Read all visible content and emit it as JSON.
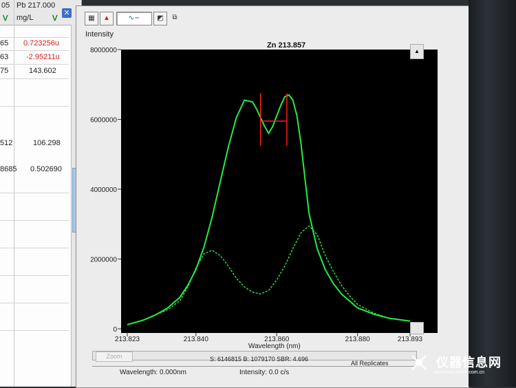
{
  "left_table": {
    "col1_header": "05",
    "col2_header": "Pb 217.000",
    "col1_unit_icon": "tuning-fork-icon",
    "col2_unit": "mg/L",
    "rows": [
      {
        "a": "65",
        "b": "0.723256u",
        "b_red": true
      },
      {
        "a": "63",
        "b": "-2.95211u",
        "b_red": true
      },
      {
        "a": "75",
        "b": "143.602",
        "b_red": false
      },
      {
        "a": "",
        "b": "",
        "b_red": false
      },
      {
        "a": "",
        "b": "",
        "b_red": false
      },
      {
        "a": "512",
        "b": "106.298",
        "b_red": false
      },
      {
        "a": "8685",
        "b": "0.502690",
        "b_red": false
      }
    ]
  },
  "chart_window": {
    "toolbar": [
      "grid-icon",
      "peak-icon",
      "spectrum-icon",
      "flag-icon",
      "copy-icon"
    ],
    "zoom_label": "Zoom",
    "status_line1": "S: 6146815 B: 1079170 SBR: 4.696",
    "all_replicates": "All Replicates",
    "status_wavelength": "Wavelength: 0.000nm",
    "status_intensity": "Intensity: 0.0 c/s"
  },
  "chart_data": {
    "type": "line",
    "title": "Zn 213.857",
    "xlabel": "Wavelength (nm)",
    "ylabel": "Intensity",
    "xlim": [
      213.823,
      213.893
    ],
    "ylim": [
      0,
      8000000
    ],
    "x_ticks": [
      "213.823",
      "213.840",
      "213.860",
      "213.880",
      "213.893"
    ],
    "y_ticks": [
      "0",
      "2000000",
      "4000000",
      "6000000",
      "8000000"
    ],
    "series": [
      {
        "color": "#22ee44",
        "style": "solid",
        "x": [
          213.823,
          213.827,
          213.83,
          213.833,
          213.836,
          213.838,
          213.84,
          213.842,
          213.844,
          213.846,
          213.848,
          213.85,
          213.852,
          213.854,
          213.855,
          213.856,
          213.857,
          213.858,
          213.859,
          213.86,
          213.861,
          213.862,
          213.863,
          213.864,
          213.865,
          213.866,
          213.867,
          213.868,
          213.87,
          213.872,
          213.874,
          213.876,
          213.878,
          213.88,
          213.884,
          213.888,
          213.893
        ],
        "y": [
          120000,
          250000,
          400000,
          600000,
          900000,
          1250000,
          1700000,
          2350000,
          3200000,
          4200000,
          5200000,
          6050000,
          6550000,
          6500000,
          6300000,
          6050000,
          5800000,
          5600000,
          5800000,
          6100000,
          6400000,
          6650000,
          6700000,
          6550000,
          6100000,
          5300000,
          4300000,
          3300000,
          2300000,
          1700000,
          1300000,
          1000000,
          800000,
          600000,
          420000,
          300000,
          220000
        ]
      },
      {
        "color": "#22ee44",
        "style": "dashed",
        "x": [
          213.823,
          213.827,
          213.83,
          213.833,
          213.836,
          213.838,
          213.84,
          213.842,
          213.844,
          213.846,
          213.848,
          213.85,
          213.852,
          213.854,
          213.856,
          213.858,
          213.86,
          213.862,
          213.864,
          213.866,
          213.868,
          213.87,
          213.872,
          213.874,
          213.876,
          213.878,
          213.88,
          213.884,
          213.888,
          213.893
        ],
        "y": [
          120000,
          250000,
          400000,
          550000,
          800000,
          1200000,
          1750000,
          2150000,
          2250000,
          2100000,
          1800000,
          1450000,
          1200000,
          1050000,
          1000000,
          1100000,
          1400000,
          1800000,
          2300000,
          2750000,
          2950000,
          2700000,
          2100000,
          1650000,
          1250000,
          950000,
          700000,
          450000,
          300000,
          220000
        ]
      }
    ],
    "markers": [
      {
        "type": "vline",
        "x": 213.856,
        "y_top": 6750000,
        "y_bottom": 5250000,
        "color": "#ff2020"
      },
      {
        "type": "vline",
        "x": 213.8625,
        "y_top": 6750000,
        "y_bottom": 5250000,
        "color": "#ff2020"
      },
      {
        "type": "hline",
        "x_from": 213.856,
        "x_to": 213.8625,
        "y": 5950000,
        "color": "#ff2020"
      }
    ]
  },
  "watermark": {
    "text": "仪器信息网",
    "sub": "www.instrument.com.cn"
  }
}
